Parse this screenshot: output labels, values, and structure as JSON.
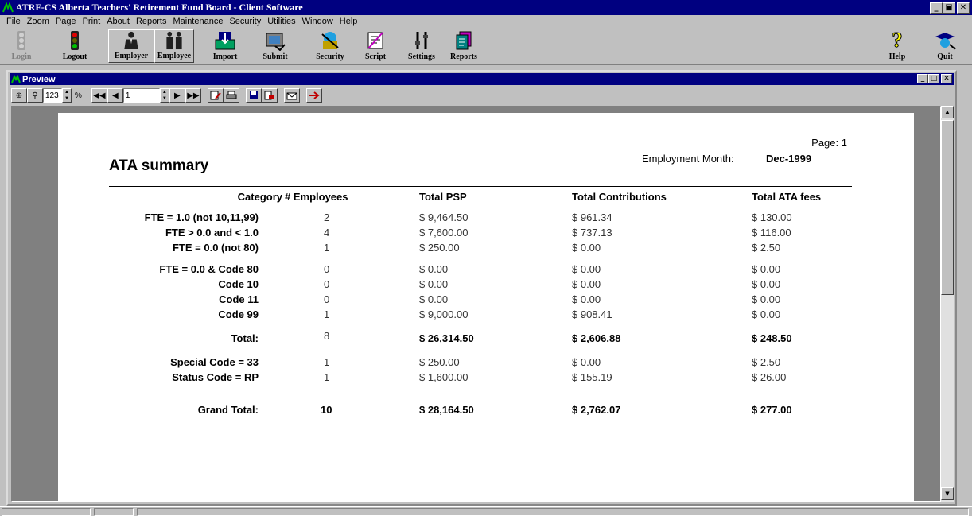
{
  "window": {
    "title": "ATRF-CS  Alberta Teachers' Retirement Fund Board - Client Software",
    "controls": [
      "minimize-icon",
      "restore-icon",
      "close-icon"
    ]
  },
  "menu": [
    "File",
    "Zoom",
    "Page",
    "Print",
    "About",
    "Reports",
    "Maintenance",
    "Security",
    "Utilities",
    "Window",
    "Help"
  ],
  "toolbar": {
    "login": "Login",
    "logout": "Logout",
    "employer": "Employer",
    "employee": "Employee",
    "import": "Import",
    "submit": "Submit",
    "security": "Security",
    "script": "Script",
    "settings": "Settings",
    "reports": "Reports",
    "help": "Help",
    "quit": "Quit"
  },
  "preview": {
    "title": "Preview",
    "zoom_value": "123",
    "zoom_unit": "%",
    "page_value": "1"
  },
  "report": {
    "title": "ATA summary",
    "page_label": "Page:",
    "page_number": "1",
    "month_label": "Employment Month:",
    "month_value": "Dec-1999",
    "headers": {
      "category": "Category",
      "employees": "# Employees",
      "psp": "Total PSP",
      "contributions": "Total Contributions",
      "ata_fees": "Total ATA fees"
    },
    "rows": [
      {
        "category": "FTE = 1.0 (not 10,11,99)",
        "employees": "2",
        "psp": "$ 9,464.50",
        "contributions": "$ 961.34",
        "fees": "$ 130.00"
      },
      {
        "category": "FTE > 0.0 and < 1.0",
        "employees": "4",
        "psp": "$ 7,600.00",
        "contributions": "$ 737.13",
        "fees": "$ 116.00"
      },
      {
        "category": "FTE = 0.0 (not 80)",
        "employees": "1",
        "psp": "$ 250.00",
        "contributions": "$ 0.00",
        "fees": "$ 2.50"
      },
      {
        "category": "FTE = 0.0 & Code 80",
        "employees": "0",
        "psp": "$ 0.00",
        "contributions": "$ 0.00",
        "fees": "$ 0.00"
      },
      {
        "category": "Code 10",
        "employees": "0",
        "psp": "$ 0.00",
        "contributions": "$ 0.00",
        "fees": "$ 0.00"
      },
      {
        "category": "Code 11",
        "employees": "0",
        "psp": "$ 0.00",
        "contributions": "$ 0.00",
        "fees": "$ 0.00"
      },
      {
        "category": "Code 99",
        "employees": "1",
        "psp": "$ 9,000.00",
        "contributions": "$ 908.41",
        "fees": "$ 0.00"
      }
    ],
    "total": {
      "label": "Total:",
      "employees": "8",
      "psp": "$ 26,314.50",
      "contributions": "$ 2,606.88",
      "fees": "$ 248.50"
    },
    "special_rows": [
      {
        "category": "Special Code = 33",
        "employees": "1",
        "psp": "$ 250.00",
        "contributions": "$ 0.00",
        "fees": "$ 2.50"
      },
      {
        "category": "Status Code = RP",
        "employees": "1",
        "psp": "$ 1,600.00",
        "contributions": "$ 155.19",
        "fees": "$ 26.00"
      }
    ],
    "grand_total": {
      "label": "Grand Total:",
      "employees": "10",
      "psp": "$ 28,164.50",
      "contributions": "$ 2,762.07",
      "fees": "$ 277.00"
    }
  },
  "colors": {
    "title_bar": "#000080",
    "face": "#c0c0c0",
    "preview_bg": "#808080"
  }
}
